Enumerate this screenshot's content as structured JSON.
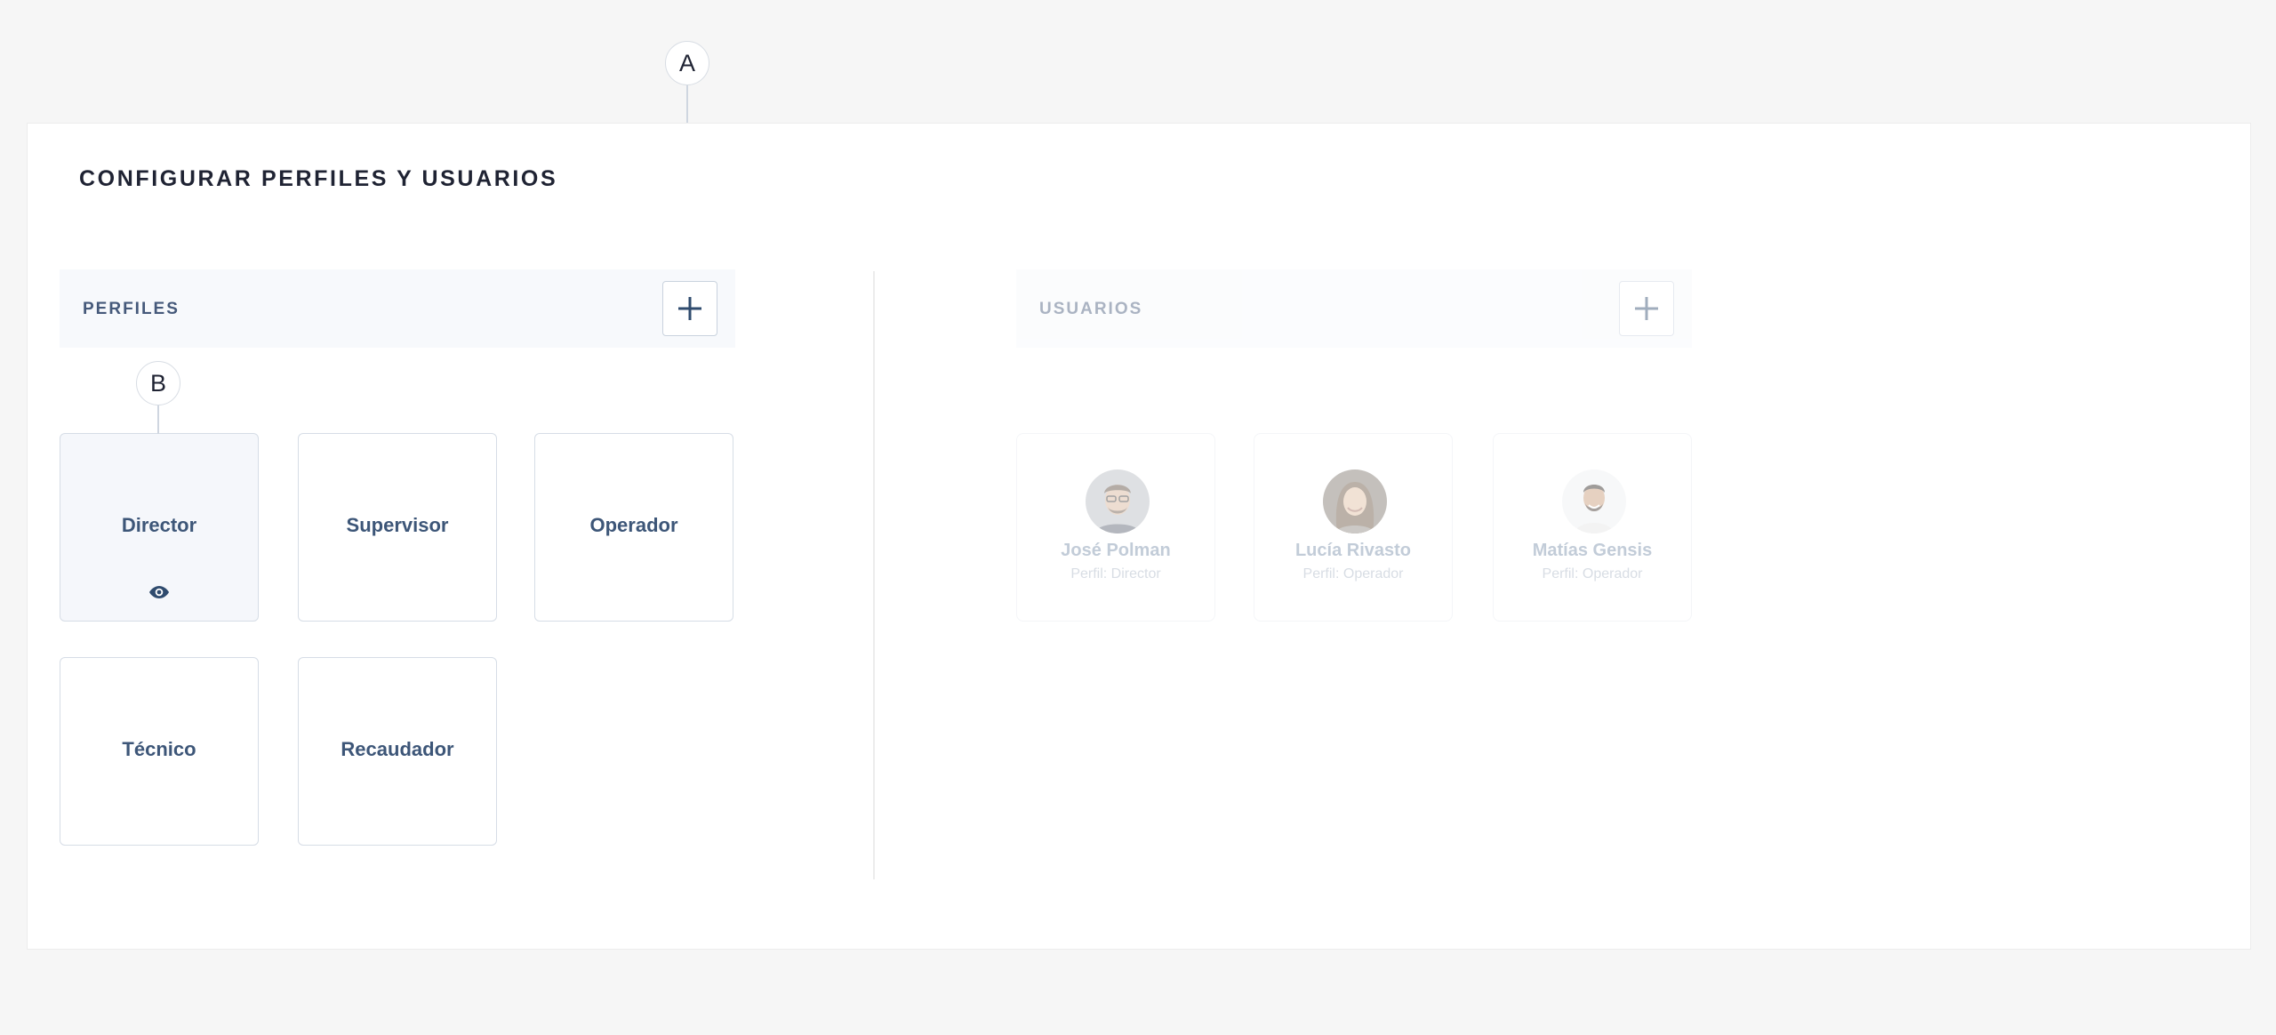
{
  "page": {
    "title": "CONFIGURAR PERFILES Y USUARIOS"
  },
  "callouts": {
    "a": "A",
    "b": "B"
  },
  "profiles": {
    "header": "PERFILES",
    "add_icon": "plus-icon",
    "items": [
      {
        "label": "Director",
        "selected": true,
        "icon": "eye-icon"
      },
      {
        "label": "Supervisor"
      },
      {
        "label": "Operador"
      },
      {
        "label": "Técnico"
      },
      {
        "label": "Recaudador"
      }
    ]
  },
  "users": {
    "header": "USUARIOS",
    "add_icon": "plus-icon",
    "items": [
      {
        "name": "José Polman",
        "profile": "Perfil: Director"
      },
      {
        "name": "Lucía Rivasto",
        "profile": "Perfil: Operador"
      },
      {
        "name": "Matías Gensis",
        "profile": "Perfil: Operador"
      }
    ]
  },
  "colors": {
    "accent": "#2f4b6e",
    "card_border": "#d6dde6",
    "header_bg": "#f7f9fc",
    "background": "#f6f6f6"
  }
}
